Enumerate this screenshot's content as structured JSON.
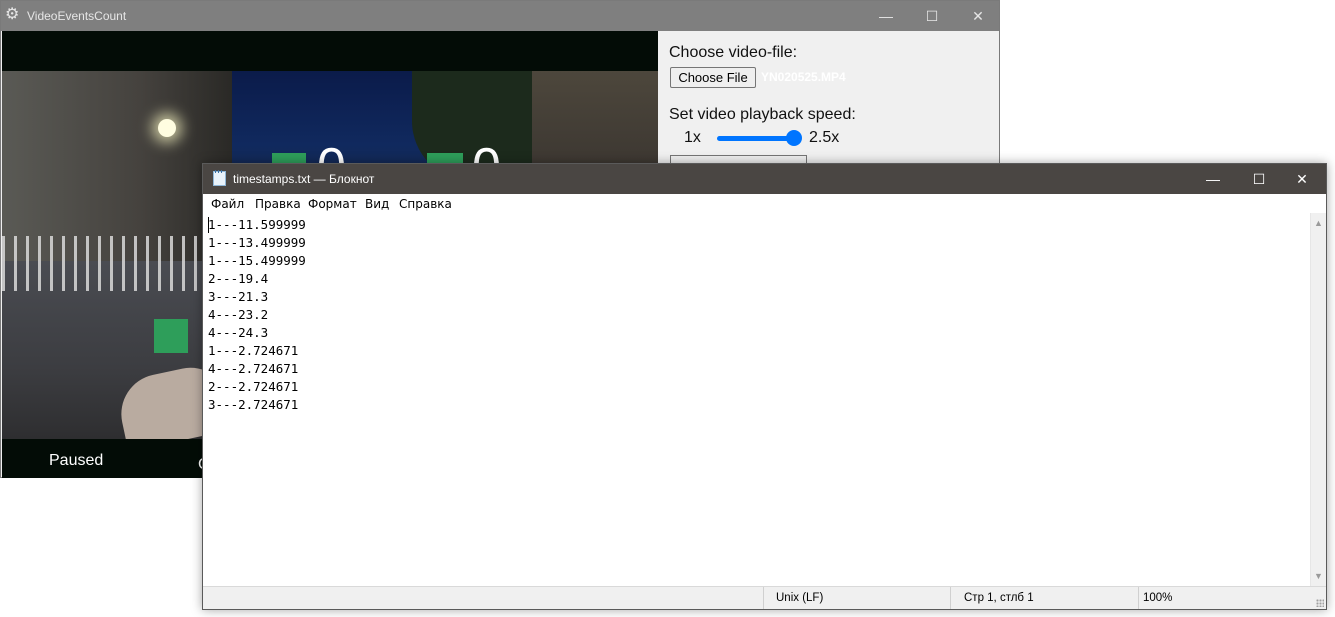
{
  "video_app": {
    "title": "VideoEventsCount",
    "counters": [
      "0",
      "0"
    ],
    "status": "Paused",
    "status_fragment": "C",
    "choose_label": "Choose video-file:",
    "choose_button": "Choose File",
    "file_name": "YN020525.MP4",
    "speed_label": "Set video playback speed:",
    "speed_min": "1x",
    "speed_max": "2.5x",
    "speed_value": 2.5
  },
  "notepad": {
    "title": "timestamps.txt — Блокнот",
    "menu": [
      "Файл",
      "Правка",
      "Формат",
      "Вид",
      "Справка"
    ],
    "lines": [
      "1---11.599999",
      "1---13.499999",
      "1---15.499999",
      "2---19.4",
      "3---21.3",
      "4---23.2",
      "4---24.3",
      "1---2.724671",
      "4---2.724671",
      "2---2.724671",
      "3---2.724671"
    ],
    "status": {
      "line_ending": "Unix (LF)",
      "position": "Стр 1, стлб 1",
      "zoom": "100%"
    }
  }
}
